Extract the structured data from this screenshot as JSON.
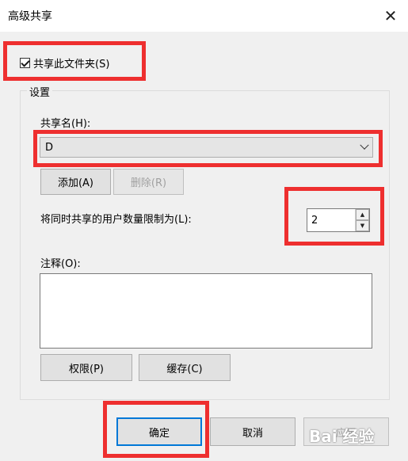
{
  "window": {
    "title": "高级共享",
    "close_glyph": "✕"
  },
  "share_checkbox": {
    "label": "共享此文件夹(S)",
    "checked": true
  },
  "settings": {
    "group_label": "设置",
    "share_name_label": "共享名(H):",
    "share_name_value": "D",
    "add_button": "添加(A)",
    "remove_button": "删除(R)",
    "user_limit_label": "将同时共享的用户数量限制为(L):",
    "user_limit_value": "2",
    "spin_up": "▲",
    "spin_down": "▼",
    "comment_label": "注释(O):",
    "comment_value": "",
    "permissions_button": "权限(P)",
    "cache_button": "缓存(C)"
  },
  "footer": {
    "ok_button": "确定",
    "cancel_button": "取消",
    "apply_button": "应用"
  },
  "watermark": {
    "text": "Bai 经验"
  },
  "colors": {
    "highlight": "#ee2f2f",
    "focus": "#0078d7",
    "background": "#f0f0f0"
  }
}
